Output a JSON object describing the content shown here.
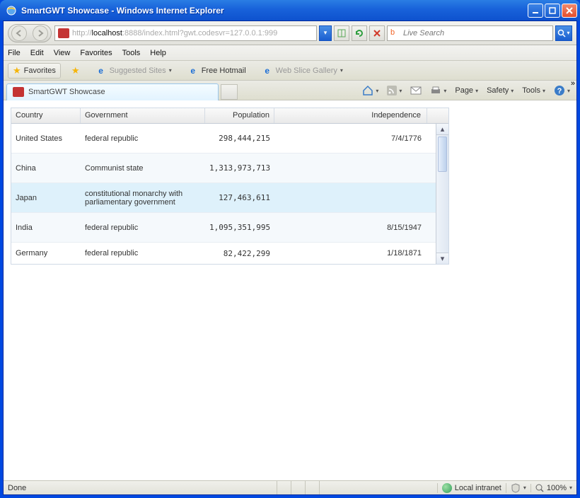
{
  "window": {
    "title": "SmartGWT Showcase - Windows Internet Explorer"
  },
  "address": {
    "prefix": "http://",
    "host": "localhost",
    "port_path": ":8888/index.html?gwt.codesvr=127.0.0.1:999"
  },
  "search": {
    "placeholder": "Live Search"
  },
  "menus": {
    "file": "File",
    "edit": "Edit",
    "view": "View",
    "favorites": "Favorites",
    "tools": "Tools",
    "help": "Help"
  },
  "favbar": {
    "favorites": "Favorites",
    "suggested": "Suggested Sites",
    "hotmail": "Free Hotmail",
    "webslice": "Web Slice Gallery"
  },
  "tab": {
    "label": "SmartGWT Showcase"
  },
  "cmd": {
    "page": "Page",
    "safety": "Safety",
    "tools": "Tools"
  },
  "grid": {
    "headers": {
      "country": "Country",
      "government": "Government",
      "population": "Population",
      "independence": "Independence"
    },
    "rows": [
      {
        "country": "United States",
        "government": "federal republic",
        "population": "298,444,215",
        "independence": "7/4/1776"
      },
      {
        "country": "China",
        "government": "Communist state",
        "population": "1,313,973,713",
        "independence": ""
      },
      {
        "country": "Japan",
        "government": "constitutional monarchy with parliamentary government",
        "population": "127,463,611",
        "independence": ""
      },
      {
        "country": "India",
        "government": "federal republic",
        "population": "1,095,351,995",
        "independence": "8/15/1947"
      },
      {
        "country": "Germany",
        "government": "federal republic",
        "population": "82,422,299",
        "independence": "1/18/1871"
      }
    ]
  },
  "status": {
    "text": "Done",
    "zone": "Local intranet",
    "zoom": "100%"
  }
}
